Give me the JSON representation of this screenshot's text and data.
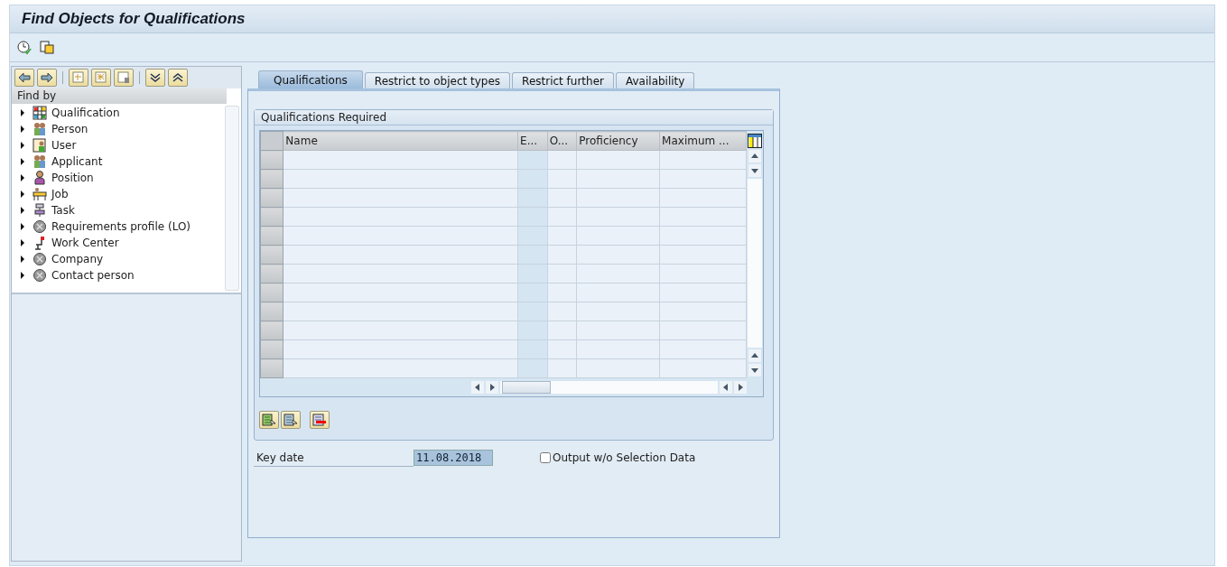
{
  "window": {
    "title": "Find Objects for Qualifications"
  },
  "sidebar": {
    "header": "Find by",
    "items": [
      {
        "label": "Qualification",
        "kind": "grid",
        "expanded": false
      },
      {
        "label": "Person",
        "kind": "people",
        "expanded": false
      },
      {
        "label": "User",
        "kind": "user",
        "expanded": false
      },
      {
        "label": "Applicant",
        "kind": "people",
        "expanded": false
      },
      {
        "label": "Position",
        "kind": "person",
        "expanded": false
      },
      {
        "label": "Job",
        "kind": "desk",
        "expanded": false
      },
      {
        "label": "Task",
        "kind": "task",
        "expanded": false
      },
      {
        "label": "Requirements profile (LO)",
        "kind": "generic",
        "expanded": false
      },
      {
        "label": "Work Center",
        "kind": "chair",
        "expanded": false
      },
      {
        "label": "Company",
        "kind": "generic",
        "expanded": false
      },
      {
        "label": "Contact person",
        "kind": "generic",
        "expanded": false
      }
    ]
  },
  "tabs": [
    {
      "label": "Qualifications",
      "selected": true
    },
    {
      "label": "Restrict to object types",
      "selected": false
    },
    {
      "label": "Restrict further",
      "selected": false
    },
    {
      "label": "Availability",
      "selected": false
    }
  ],
  "group": {
    "title": "Qualifications Required"
  },
  "table": {
    "columns": [
      "Name",
      "E...",
      "O...",
      "Proficiency",
      "Maximum ..."
    ]
  },
  "key_date": {
    "label": "Key date",
    "value": "11.08.2018"
  },
  "output_checkbox": {
    "label": "Output w/o Selection Data",
    "checked": false
  }
}
